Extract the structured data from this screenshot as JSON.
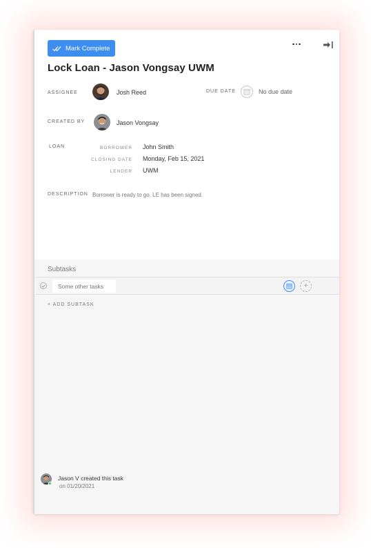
{
  "toolbar": {
    "mark_complete_label": "Mark Complete",
    "more_icon": "ellipsis-icon",
    "exit_icon": "arrow-right-to-line-icon"
  },
  "task": {
    "title": "Lock Loan - Jason Vongsay UWM",
    "assignee_label": "ASSIGNEE",
    "assignee_name": "Josh Reed",
    "due_date_label": "DUE DATE",
    "due_date_value": "No due date",
    "created_by_label": "CREATED BY",
    "created_by_name": "Jason Vongsay",
    "loan_label": "LOAN",
    "loan": {
      "borrower_label": "BORROWER",
      "borrower_value": "John Smith",
      "closing_date_label": "CLOSING DATE",
      "closing_date_value": "Monday, Feb 15, 2021",
      "lender_label": "LENDER",
      "lender_value": "UWM"
    },
    "description_label": "DESCRIPTION",
    "description_value": "Borrower is ready to go. LE has been signed."
  },
  "subtasks": {
    "title": "Subtasks",
    "items": [
      {
        "placeholder": "Some other tasks"
      }
    ],
    "add_label": "+ ADD SUBTASK"
  },
  "activity": {
    "text": "Jason V created this task",
    "date": "on 01/20/2021"
  },
  "colors": {
    "accent": "#3d8ef0",
    "online": "#3cc45a"
  }
}
